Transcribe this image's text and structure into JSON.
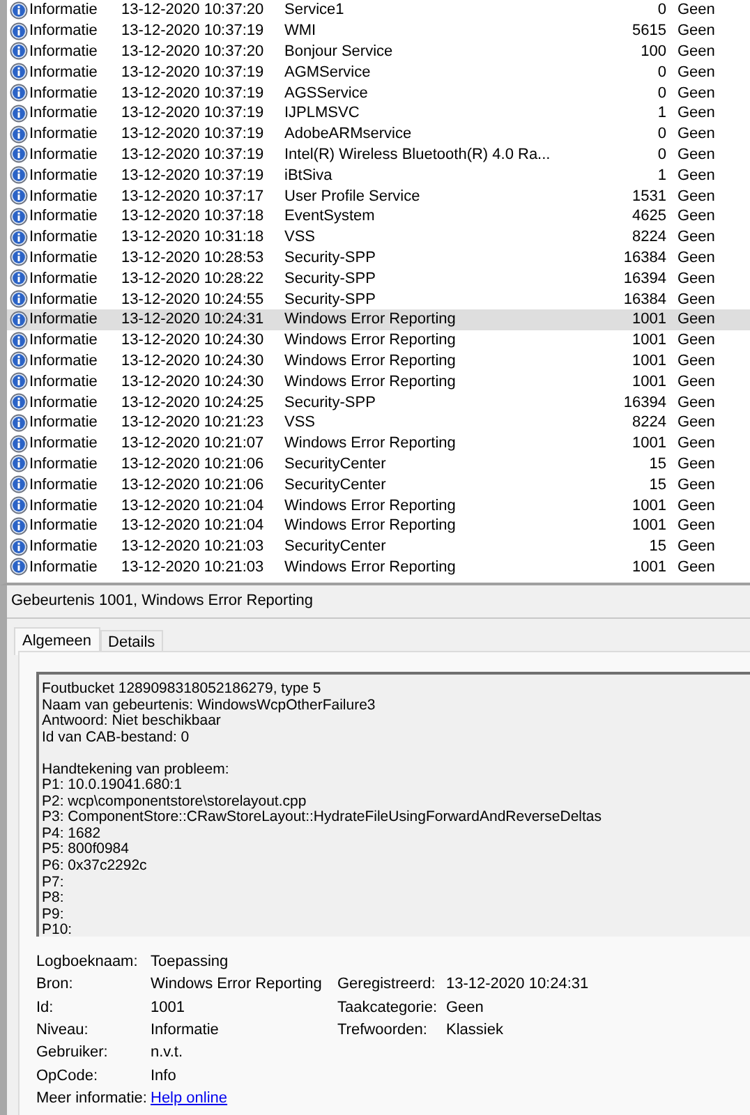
{
  "events": [
    {
      "level": "Informatie",
      "date": "13-12-2020 10:37:20",
      "source": "Service1",
      "id": "0",
      "category": "Geen",
      "selected": false
    },
    {
      "level": "Informatie",
      "date": "13-12-2020 10:37:19",
      "source": "WMI",
      "id": "5615",
      "category": "Geen",
      "selected": false
    },
    {
      "level": "Informatie",
      "date": "13-12-2020 10:37:20",
      "source": "Bonjour Service",
      "id": "100",
      "category": "Geen",
      "selected": false
    },
    {
      "level": "Informatie",
      "date": "13-12-2020 10:37:19",
      "source": "AGMService",
      "id": "0",
      "category": "Geen",
      "selected": false
    },
    {
      "level": "Informatie",
      "date": "13-12-2020 10:37:19",
      "source": "AGSService",
      "id": "0",
      "category": "Geen",
      "selected": false
    },
    {
      "level": "Informatie",
      "date": "13-12-2020 10:37:19",
      "source": "IJPLMSVC",
      "id": "1",
      "category": "Geen",
      "selected": false
    },
    {
      "level": "Informatie",
      "date": "13-12-2020 10:37:19",
      "source": "AdobeARMservice",
      "id": "0",
      "category": "Geen",
      "selected": false
    },
    {
      "level": "Informatie",
      "date": "13-12-2020 10:37:19",
      "source": "Intel(R) Wireless Bluetooth(R) 4.0 Ra...",
      "id": "0",
      "category": "Geen",
      "selected": false
    },
    {
      "level": "Informatie",
      "date": "13-12-2020 10:37:19",
      "source": "iBtSiva",
      "id": "1",
      "category": "Geen",
      "selected": false
    },
    {
      "level": "Informatie",
      "date": "13-12-2020 10:37:17",
      "source": "User Profile Service",
      "id": "1531",
      "category": "Geen",
      "selected": false
    },
    {
      "level": "Informatie",
      "date": "13-12-2020 10:37:18",
      "source": "EventSystem",
      "id": "4625",
      "category": "Geen",
      "selected": false
    },
    {
      "level": "Informatie",
      "date": "13-12-2020 10:31:18",
      "source": "VSS",
      "id": "8224",
      "category": "Geen",
      "selected": false
    },
    {
      "level": "Informatie",
      "date": "13-12-2020 10:28:53",
      "source": "Security-SPP",
      "id": "16384",
      "category": "Geen",
      "selected": false
    },
    {
      "level": "Informatie",
      "date": "13-12-2020 10:28:22",
      "source": "Security-SPP",
      "id": "16394",
      "category": "Geen",
      "selected": false
    },
    {
      "level": "Informatie",
      "date": "13-12-2020 10:24:55",
      "source": "Security-SPP",
      "id": "16384",
      "category": "Geen",
      "selected": false
    },
    {
      "level": "Informatie",
      "date": "13-12-2020 10:24:31",
      "source": "Windows Error Reporting",
      "id": "1001",
      "category": "Geen",
      "selected": true
    },
    {
      "level": "Informatie",
      "date": "13-12-2020 10:24:30",
      "source": "Windows Error Reporting",
      "id": "1001",
      "category": "Geen",
      "selected": false
    },
    {
      "level": "Informatie",
      "date": "13-12-2020 10:24:30",
      "source": "Windows Error Reporting",
      "id": "1001",
      "category": "Geen",
      "selected": false
    },
    {
      "level": "Informatie",
      "date": "13-12-2020 10:24:30",
      "source": "Windows Error Reporting",
      "id": "1001",
      "category": "Geen",
      "selected": false
    },
    {
      "level": "Informatie",
      "date": "13-12-2020 10:24:25",
      "source": "Security-SPP",
      "id": "16394",
      "category": "Geen",
      "selected": false
    },
    {
      "level": "Informatie",
      "date": "13-12-2020 10:21:23",
      "source": "VSS",
      "id": "8224",
      "category": "Geen",
      "selected": false
    },
    {
      "level": "Informatie",
      "date": "13-12-2020 10:21:07",
      "source": "Windows Error Reporting",
      "id": "1001",
      "category": "Geen",
      "selected": false
    },
    {
      "level": "Informatie",
      "date": "13-12-2020 10:21:06",
      "source": "SecurityCenter",
      "id": "15",
      "category": "Geen",
      "selected": false
    },
    {
      "level": "Informatie",
      "date": "13-12-2020 10:21:06",
      "source": "SecurityCenter",
      "id": "15",
      "category": "Geen",
      "selected": false
    },
    {
      "level": "Informatie",
      "date": "13-12-2020 10:21:04",
      "source": "Windows Error Reporting",
      "id": "1001",
      "category": "Geen",
      "selected": false
    },
    {
      "level": "Informatie",
      "date": "13-12-2020 10:21:04",
      "source": "Windows Error Reporting",
      "id": "1001",
      "category": "Geen",
      "selected": false
    },
    {
      "level": "Informatie",
      "date": "13-12-2020 10:21:03",
      "source": "SecurityCenter",
      "id": "15",
      "category": "Geen",
      "selected": false
    },
    {
      "level": "Informatie",
      "date": "13-12-2020 10:21:03",
      "source": "Windows Error Reporting",
      "id": "1001",
      "category": "Geen",
      "selected": false
    }
  ],
  "detail": {
    "title": "Gebeurtenis 1001, Windows Error Reporting",
    "tabs": [
      {
        "label": "Algemeen",
        "selected": true
      },
      {
        "label": "Details",
        "selected": false
      }
    ],
    "description_blocks": [
      [
        "Foutbucket 1289098318052186279, type 5",
        "Naam van gebeurtenis: WindowsWcpOtherFailure3",
        "Antwoord: Niet beschikbaar",
        "Id van CAB-bestand: 0"
      ],
      [
        "Handtekening van probleem:",
        "P1: 10.0.19041.680:1",
        "P2: wcp\\componentstore\\storelayout.cpp",
        "P3: ComponentStore::CRawStoreLayout::HydrateFileUsingForwardAndReverseDeltas",
        "P4: 1682",
        "P5: 800f0984",
        "P6: 0x37c2292c",
        "P7:",
        "P8:",
        "P9:",
        "P10:"
      ]
    ],
    "fields": [
      {
        "label": "Logboeknaam:",
        "value": "Toepassing",
        "kind": "text"
      },
      {
        "label": "Bron:",
        "value": "Windows Error Reporting",
        "kind": "text",
        "extra": {
          "label": "Geregistreerd:",
          "value": "13-12-2020 10:24:31"
        }
      },
      {
        "label": "Id:",
        "value": "1001",
        "kind": "text",
        "extra": {
          "label": "Taakcategorie:",
          "value": "Geen"
        }
      },
      {
        "label": "Niveau:",
        "value": "Informatie",
        "kind": "text",
        "extra": {
          "label": "Trefwoorden:",
          "value": "Klassiek"
        }
      },
      {
        "label": "Gebruiker:",
        "value": "n.v.t.",
        "kind": "text"
      },
      {
        "label": "OpCode:",
        "value": "Info",
        "kind": "text"
      },
      {
        "label": "Meer informatie:",
        "value": "Help online",
        "kind": "link"
      }
    ]
  }
}
